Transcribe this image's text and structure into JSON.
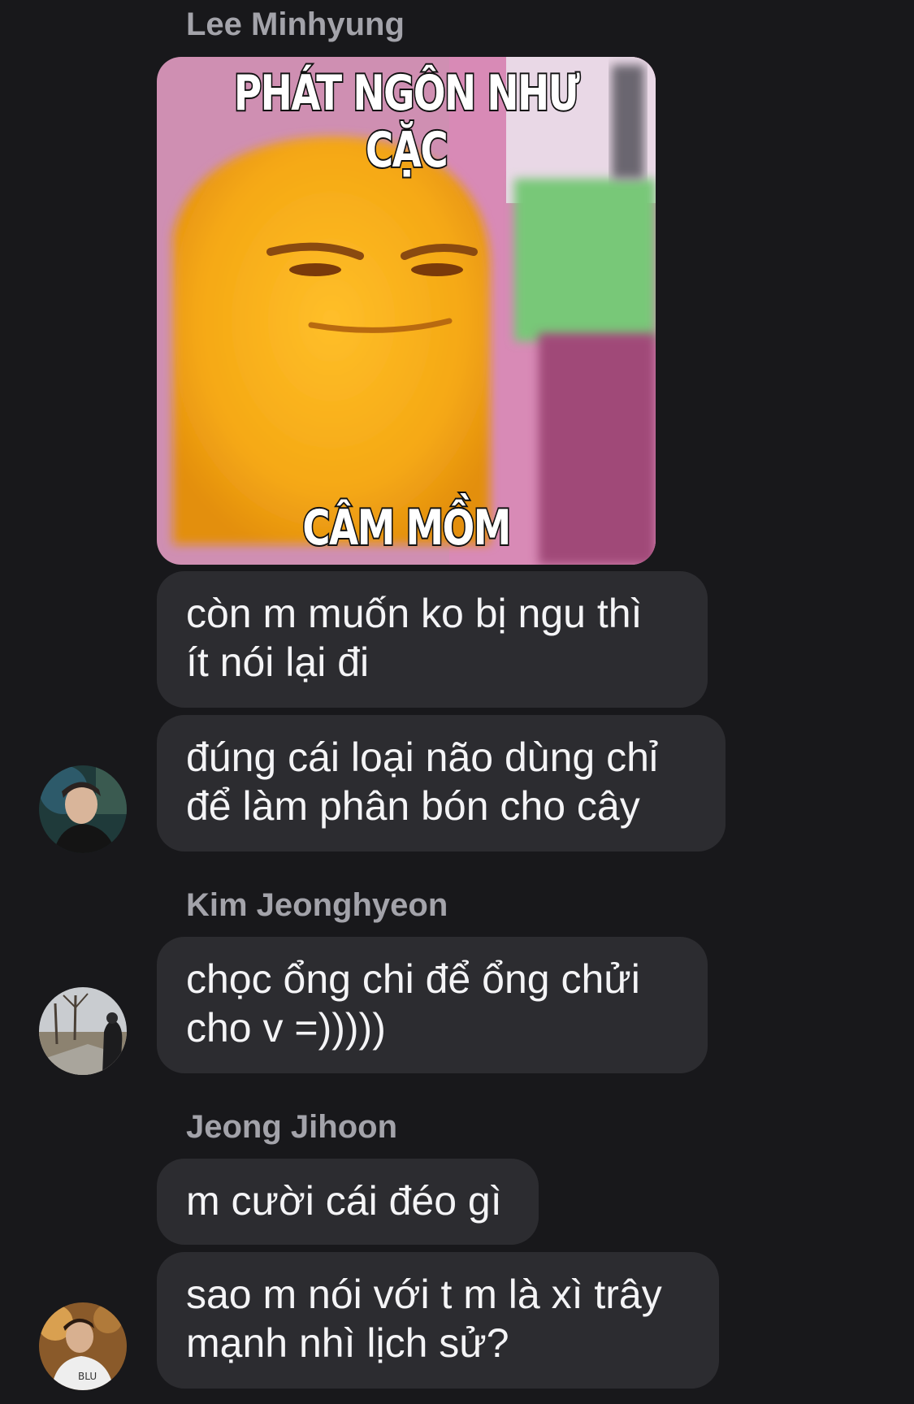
{
  "conversation": {
    "groups": [
      {
        "sender": "Lee Minhyung",
        "sticker": {
          "caption_top": "PHÁT NGÔN NHƯ CẶC",
          "caption_bottom": "CÂM MỒM",
          "icon": "yellow-blob-meme-sticker"
        },
        "messages": [
          "còn m muốn ko bị ngu thì\nít nói lại đi",
          "đúng cái loại não dùng chỉ\nđể làm phân bón cho cây"
        ],
        "avatar": "user-avatar-icon"
      },
      {
        "sender": "Kim Jeonghyeon",
        "messages": [
          "chọc ổng chi để ổng chửi\ncho v =)))))"
        ],
        "avatar": "user-avatar-icon"
      },
      {
        "sender": "Jeong Jihoon",
        "messages": [
          "m cười cái đéo gì",
          "sao m nói với t m là xì trây\nmạnh nhì lịch sử?"
        ],
        "avatar": "user-avatar-icon"
      }
    ]
  },
  "colors": {
    "background": "#18181b",
    "bubble": "#2c2c30",
    "sender_name": "#a3a3aa",
    "text": "#f4f4f6"
  }
}
